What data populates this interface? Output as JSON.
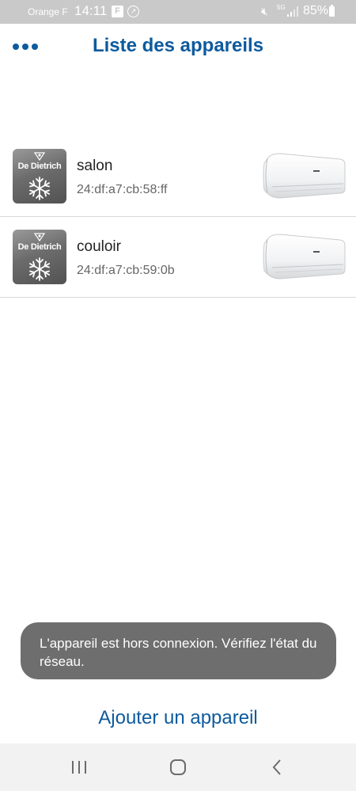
{
  "status_bar": {
    "carrier": "Orange F",
    "time": "14:11",
    "network": "5G",
    "battery": "85%"
  },
  "header": {
    "title": "Liste des appareils"
  },
  "devices": [
    {
      "brand": "De Dietrich",
      "name": "salon",
      "mac": "24:df:a7:cb:58:ff"
    },
    {
      "brand": "De Dietrich",
      "name": "couloir",
      "mac": "24:df:a7:cb:59:0b"
    }
  ],
  "toast": {
    "message": "L'appareil est hors connexion. Vérifiez l'état du réseau."
  },
  "add_device": {
    "label": "Ajouter un appareil"
  },
  "colors": {
    "accent": "#0d5a9e",
    "status_bar": "#c9c9c9",
    "toast_bg": "#6e6e6e",
    "nav_bar": "#f2f2f2"
  },
  "icons": {
    "menu": "ellipsis-icon",
    "brand": "snowflake-icon",
    "nav_recents": "recents-icon",
    "nav_home": "home-icon",
    "nav_back": "back-icon"
  }
}
